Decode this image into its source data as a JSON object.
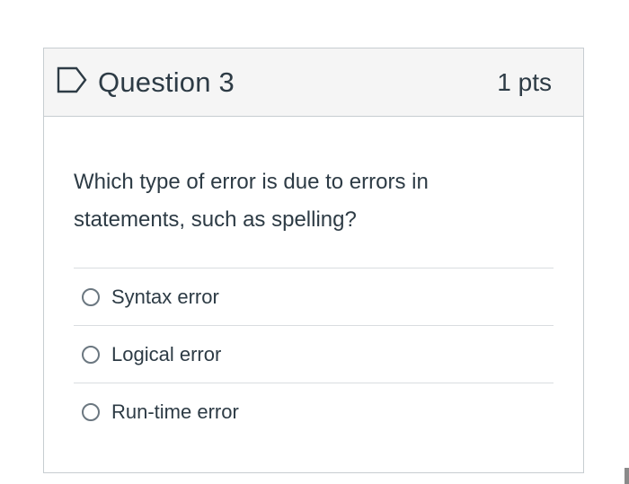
{
  "question": {
    "title": "Question 3",
    "points": "1 pts",
    "flag_icon": "flag-outline-icon",
    "text": "Which type of error is due to errors in statements, such as spelling?"
  },
  "answers": [
    {
      "label": "Syntax error",
      "selected": false
    },
    {
      "label": "Logical error",
      "selected": false
    },
    {
      "label": "Run-time error",
      "selected": false
    }
  ],
  "colors": {
    "text": "#2d3b45",
    "header_bg": "#f5f5f5",
    "border": "#c7cdd1",
    "divider": "#d9dde0",
    "radio_border": "#6b7780"
  }
}
